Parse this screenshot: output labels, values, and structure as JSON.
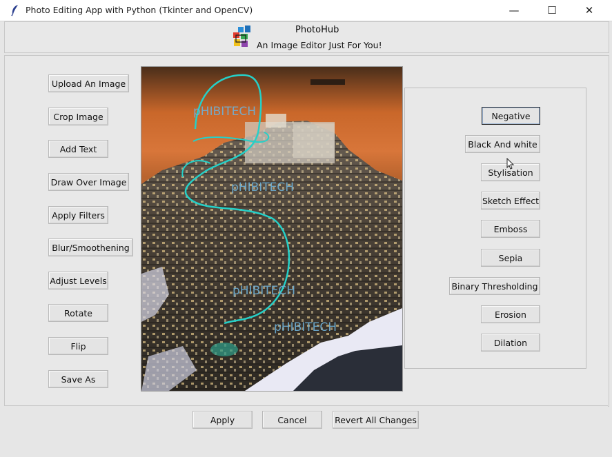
{
  "window": {
    "title": "Photo Editing App with Python (Tkinter and OpenCV)",
    "minimize_glyph": "—",
    "maximize_glyph": "☐",
    "close_glyph": "✕"
  },
  "header": {
    "title": "PhotoHub",
    "subtitle": "An Image Editor Just For You!"
  },
  "left_buttons": [
    "Upload An Image",
    "Crop Image",
    "Add Text",
    "Draw Over Image",
    "Apply Filters",
    "Blur/Smoothening",
    "Adjust Levels",
    "Rotate",
    "Flip",
    "Save As"
  ],
  "filter_buttons": [
    "Negative",
    "Black And white",
    "Stylisation",
    "Sketch Effect",
    "Emboss",
    "Sepia",
    "Binary Thresholding",
    "Erosion",
    "Dilation"
  ],
  "canvas": {
    "watermarks": [
      "pHIBITECH",
      "pHIBITECH",
      "pHIBITECH",
      "pHIBITECH"
    ]
  },
  "footer_buttons": [
    "Apply",
    "Cancel",
    "Revert All Changes"
  ],
  "colors": {
    "sky": "#c9672a",
    "sky_dark": "#4a2e1a",
    "stroke": "#25d0c8",
    "watermark": "#6fb0d6",
    "ground": "#e9e9f4"
  }
}
